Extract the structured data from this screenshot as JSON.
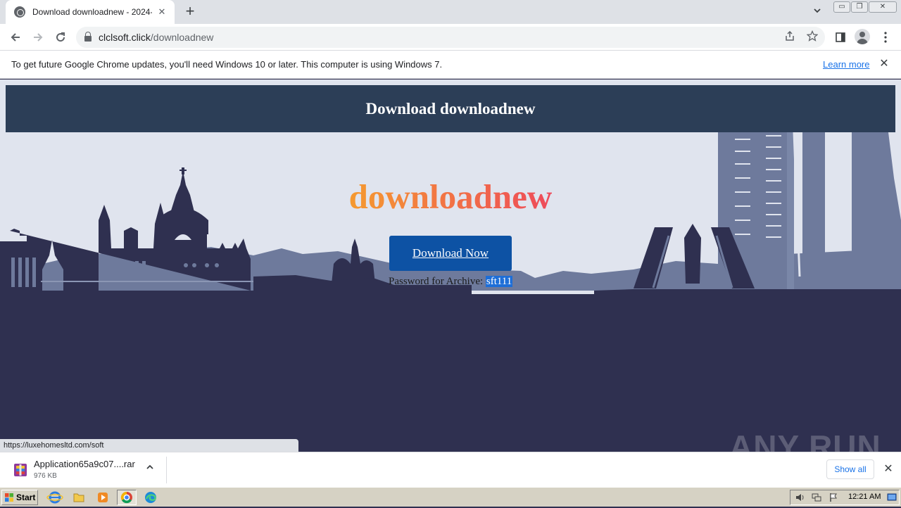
{
  "browser": {
    "tab_title": "Download downloadnew - 2024-01-",
    "tab_close": "✕",
    "new_tab": "+",
    "url_host": "clclsoft.click",
    "url_path": "/downloadnew",
    "infobar": {
      "message": "To get future Google Chrome updates, you'll need Windows 10 or later. This computer is using Windows 7.",
      "link": "Learn more",
      "close": "✕"
    },
    "status_url": "https://luxehomesltd.com/soft"
  },
  "page": {
    "header_title": "Download downloadnew",
    "brand_title": "downloadnew",
    "download_button": "Download Now",
    "password_label": "Password for Archive: ",
    "password_value": "sft111",
    "colors": {
      "header_bg": "#2c3e57",
      "button_bg": "#0d52a4",
      "title_gradient_start": "#f59a30",
      "title_gradient_end": "#ee4a5a",
      "skyline_dark": "#2f3050",
      "skyline_mid": "#6e7a9c",
      "sky_bg": "#e0e4ee"
    }
  },
  "download_shelf": {
    "file_name": "Application65a9c07....rar",
    "file_size": "976 KB",
    "show_all": "Show all",
    "close": "✕"
  },
  "watermark": "ANY RUN",
  "taskbar": {
    "start_label": "Start",
    "clock": "12:21 AM",
    "apps": [
      "internet-explorer",
      "file-explorer",
      "media-player",
      "chrome",
      "edge"
    ]
  }
}
